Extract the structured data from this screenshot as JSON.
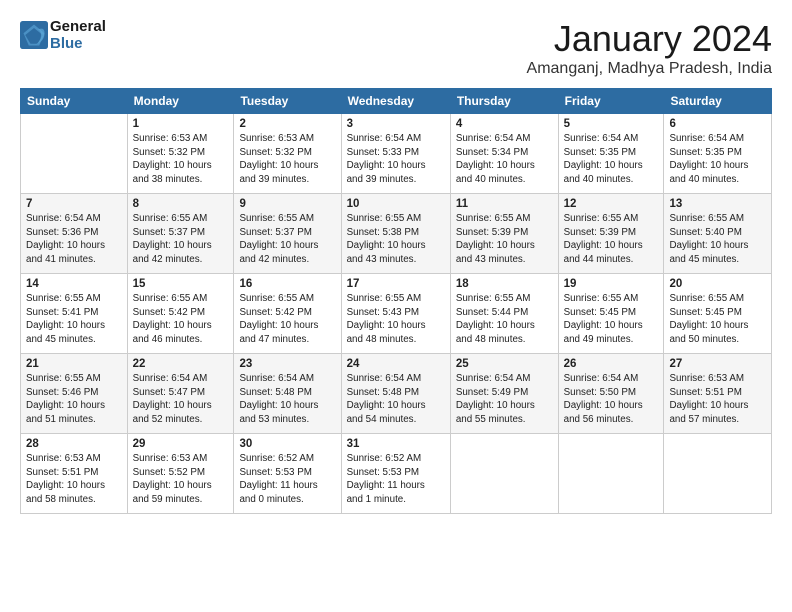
{
  "logo": {
    "line1": "General",
    "line2": "Blue"
  },
  "title": "January 2024",
  "subtitle": "Amanganj, Madhya Pradesh, India",
  "header": {
    "days": [
      "Sunday",
      "Monday",
      "Tuesday",
      "Wednesday",
      "Thursday",
      "Friday",
      "Saturday"
    ]
  },
  "weeks": [
    [
      {
        "num": "",
        "detail": ""
      },
      {
        "num": "1",
        "detail": "Sunrise: 6:53 AM\nSunset: 5:32 PM\nDaylight: 10 hours\nand 38 minutes."
      },
      {
        "num": "2",
        "detail": "Sunrise: 6:53 AM\nSunset: 5:32 PM\nDaylight: 10 hours\nand 39 minutes."
      },
      {
        "num": "3",
        "detail": "Sunrise: 6:54 AM\nSunset: 5:33 PM\nDaylight: 10 hours\nand 39 minutes."
      },
      {
        "num": "4",
        "detail": "Sunrise: 6:54 AM\nSunset: 5:34 PM\nDaylight: 10 hours\nand 40 minutes."
      },
      {
        "num": "5",
        "detail": "Sunrise: 6:54 AM\nSunset: 5:35 PM\nDaylight: 10 hours\nand 40 minutes."
      },
      {
        "num": "6",
        "detail": "Sunrise: 6:54 AM\nSunset: 5:35 PM\nDaylight: 10 hours\nand 40 minutes."
      }
    ],
    [
      {
        "num": "7",
        "detail": "Sunrise: 6:54 AM\nSunset: 5:36 PM\nDaylight: 10 hours\nand 41 minutes."
      },
      {
        "num": "8",
        "detail": "Sunrise: 6:55 AM\nSunset: 5:37 PM\nDaylight: 10 hours\nand 42 minutes."
      },
      {
        "num": "9",
        "detail": "Sunrise: 6:55 AM\nSunset: 5:37 PM\nDaylight: 10 hours\nand 42 minutes."
      },
      {
        "num": "10",
        "detail": "Sunrise: 6:55 AM\nSunset: 5:38 PM\nDaylight: 10 hours\nand 43 minutes."
      },
      {
        "num": "11",
        "detail": "Sunrise: 6:55 AM\nSunset: 5:39 PM\nDaylight: 10 hours\nand 43 minutes."
      },
      {
        "num": "12",
        "detail": "Sunrise: 6:55 AM\nSunset: 5:39 PM\nDaylight: 10 hours\nand 44 minutes."
      },
      {
        "num": "13",
        "detail": "Sunrise: 6:55 AM\nSunset: 5:40 PM\nDaylight: 10 hours\nand 45 minutes."
      }
    ],
    [
      {
        "num": "14",
        "detail": "Sunrise: 6:55 AM\nSunset: 5:41 PM\nDaylight: 10 hours\nand 45 minutes."
      },
      {
        "num": "15",
        "detail": "Sunrise: 6:55 AM\nSunset: 5:42 PM\nDaylight: 10 hours\nand 46 minutes."
      },
      {
        "num": "16",
        "detail": "Sunrise: 6:55 AM\nSunset: 5:42 PM\nDaylight: 10 hours\nand 47 minutes."
      },
      {
        "num": "17",
        "detail": "Sunrise: 6:55 AM\nSunset: 5:43 PM\nDaylight: 10 hours\nand 48 minutes."
      },
      {
        "num": "18",
        "detail": "Sunrise: 6:55 AM\nSunset: 5:44 PM\nDaylight: 10 hours\nand 48 minutes."
      },
      {
        "num": "19",
        "detail": "Sunrise: 6:55 AM\nSunset: 5:45 PM\nDaylight: 10 hours\nand 49 minutes."
      },
      {
        "num": "20",
        "detail": "Sunrise: 6:55 AM\nSunset: 5:45 PM\nDaylight: 10 hours\nand 50 minutes."
      }
    ],
    [
      {
        "num": "21",
        "detail": "Sunrise: 6:55 AM\nSunset: 5:46 PM\nDaylight: 10 hours\nand 51 minutes."
      },
      {
        "num": "22",
        "detail": "Sunrise: 6:54 AM\nSunset: 5:47 PM\nDaylight: 10 hours\nand 52 minutes."
      },
      {
        "num": "23",
        "detail": "Sunrise: 6:54 AM\nSunset: 5:48 PM\nDaylight: 10 hours\nand 53 minutes."
      },
      {
        "num": "24",
        "detail": "Sunrise: 6:54 AM\nSunset: 5:48 PM\nDaylight: 10 hours\nand 54 minutes."
      },
      {
        "num": "25",
        "detail": "Sunrise: 6:54 AM\nSunset: 5:49 PM\nDaylight: 10 hours\nand 55 minutes."
      },
      {
        "num": "26",
        "detail": "Sunrise: 6:54 AM\nSunset: 5:50 PM\nDaylight: 10 hours\nand 56 minutes."
      },
      {
        "num": "27",
        "detail": "Sunrise: 6:53 AM\nSunset: 5:51 PM\nDaylight: 10 hours\nand 57 minutes."
      }
    ],
    [
      {
        "num": "28",
        "detail": "Sunrise: 6:53 AM\nSunset: 5:51 PM\nDaylight: 10 hours\nand 58 minutes."
      },
      {
        "num": "29",
        "detail": "Sunrise: 6:53 AM\nSunset: 5:52 PM\nDaylight: 10 hours\nand 59 minutes."
      },
      {
        "num": "30",
        "detail": "Sunrise: 6:52 AM\nSunset: 5:53 PM\nDaylight: 11 hours\nand 0 minutes."
      },
      {
        "num": "31",
        "detail": "Sunrise: 6:52 AM\nSunset: 5:53 PM\nDaylight: 11 hours\nand 1 minute."
      },
      {
        "num": "",
        "detail": ""
      },
      {
        "num": "",
        "detail": ""
      },
      {
        "num": "",
        "detail": ""
      }
    ]
  ]
}
